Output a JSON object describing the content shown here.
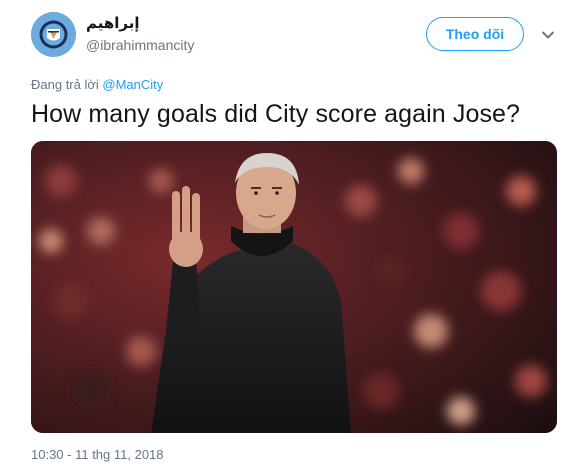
{
  "user": {
    "display_name": "إبراهيم",
    "handle": "@ibrahimmancity",
    "avatar_icon": "man-city-crest-icon"
  },
  "follow_button": {
    "label": "Theo dõi"
  },
  "menu_icon": "chevron-down-icon",
  "reply": {
    "prefix": "Đang trả lời ",
    "mention": "@ManCity"
  },
  "tweet": {
    "text": "How many goals did City score again Jose?"
  },
  "media": {
    "alt": "photo-of-man-in-black-coat-raising-three-fingers",
    "icon": "photo-icon"
  },
  "timestamp": "10:30 - 11 thg 11, 2018",
  "colors": {
    "accent": "#1da1f2",
    "text": "#14171a",
    "muted": "#657786",
    "city_blue": "#6cabdd"
  }
}
